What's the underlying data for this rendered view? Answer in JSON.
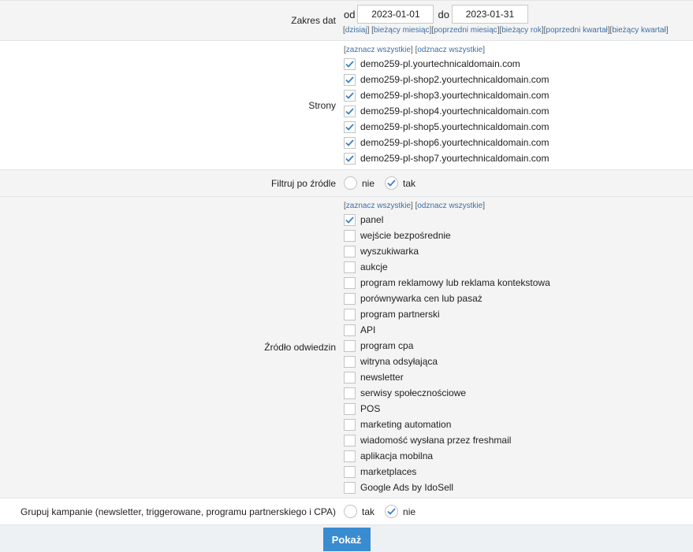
{
  "date_range": {
    "label": "Zakres dat",
    "from_label": "od",
    "from_value": "2023-01-01",
    "to_label": "do",
    "to_value": "2023-01-31",
    "quick_links": [
      "dzisiaj",
      "bieżący miesiąc",
      "poprzedni miesiąc",
      "bieżący rok",
      "poprzedni kwartał",
      "bieżący kwartał"
    ]
  },
  "shops": {
    "label": "Strony",
    "select_all": "zaznacz wszystkie",
    "deselect_all": "odznacz wszystkie",
    "items": [
      {
        "label": "demo259-pl.yourtechnicaldomain.com",
        "checked": true
      },
      {
        "label": "demo259-pl-shop2.yourtechnicaldomain.com",
        "checked": true
      },
      {
        "label": "demo259-pl-shop3.yourtechnicaldomain.com",
        "checked": true
      },
      {
        "label": "demo259-pl-shop4.yourtechnicaldomain.com",
        "checked": true
      },
      {
        "label": "demo259-pl-shop5.yourtechnicaldomain.com",
        "checked": true
      },
      {
        "label": "demo259-pl-shop6.yourtechnicaldomain.com",
        "checked": true
      },
      {
        "label": "demo259-pl-shop7.yourtechnicaldomain.com",
        "checked": true
      }
    ]
  },
  "filter_source": {
    "label": "Filtruj po źródle",
    "options": [
      {
        "label": "nie",
        "checked": false
      },
      {
        "label": "tak",
        "checked": true
      }
    ]
  },
  "sources": {
    "label": "Źródło odwiedzin",
    "select_all": "zaznacz wszystkie",
    "deselect_all": "odznacz wszystkie",
    "items": [
      {
        "label": "panel",
        "checked": true
      },
      {
        "label": "wejście bezpośrednie",
        "checked": false
      },
      {
        "label": "wyszukiwarka",
        "checked": false
      },
      {
        "label": "aukcje",
        "checked": false
      },
      {
        "label": "program reklamowy lub reklama kontekstowa",
        "checked": false
      },
      {
        "label": "porównywarka cen lub pasaż",
        "checked": false
      },
      {
        "label": "program partnerski",
        "checked": false
      },
      {
        "label": "API",
        "checked": false
      },
      {
        "label": "program cpa",
        "checked": false
      },
      {
        "label": "witryna odsyłająca",
        "checked": false
      },
      {
        "label": "newsletter",
        "checked": false
      },
      {
        "label": "serwisy społecznościowe",
        "checked": false
      },
      {
        "label": "POS",
        "checked": false
      },
      {
        "label": "marketing automation",
        "checked": false
      },
      {
        "label": "wiadomość wysłana przez freshmail",
        "checked": false
      },
      {
        "label": "aplikacja mobilna",
        "checked": false
      },
      {
        "label": "marketplaces",
        "checked": false
      },
      {
        "label": "Google Ads by IdoSell",
        "checked": false
      }
    ]
  },
  "group_campaigns": {
    "label": "Grupuj kampanie (newsletter, triggerowane, programu partnerskiego i CPA)",
    "options": [
      {
        "label": "tak",
        "checked": false
      },
      {
        "label": "nie",
        "checked": true
      }
    ]
  },
  "submit_label": "Pokaż",
  "colors": {
    "accent": "#3a8cd0",
    "check": "#3a7fc4",
    "link": "#3d6fa5"
  }
}
